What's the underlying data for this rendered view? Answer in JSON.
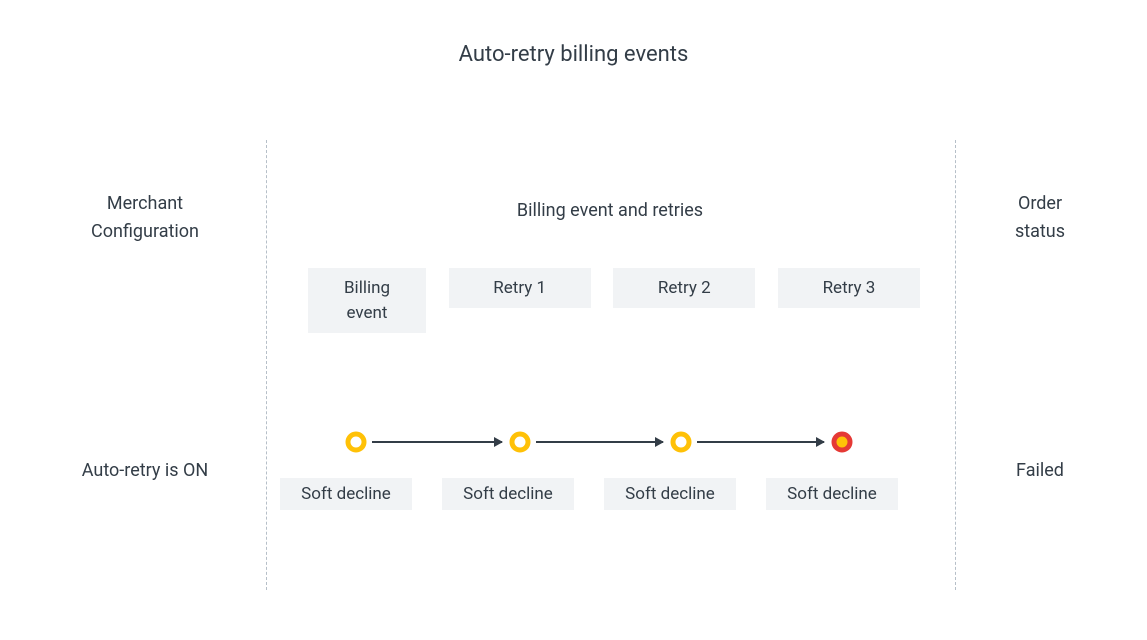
{
  "title": "Auto-retry billing events",
  "columns": {
    "left_header_line1": "Merchant",
    "left_header_line2": "Configuration",
    "mid_header": "Billing event and retries",
    "right_header_line1": "Order",
    "right_header_line2": "status"
  },
  "retry_boxes": {
    "box1_line1": "Billing",
    "box1_line2": "event",
    "box2": "Retry 1",
    "box3": "Retry 2",
    "box4": "Retry 3"
  },
  "row": {
    "config": "Auto-retry is ON",
    "status": "Failed",
    "declines": {
      "d1": "Soft decline",
      "d2": "Soft decline",
      "d3": "Soft decline",
      "d4": "Soft decline"
    }
  },
  "colors": {
    "soft_ring": "#ffc107",
    "fail_ring": "#e53935",
    "fail_fill": "#ffc107"
  }
}
